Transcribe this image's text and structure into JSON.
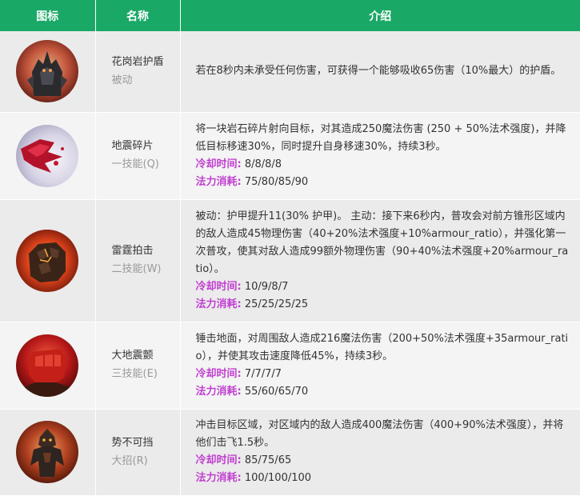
{
  "headers": {
    "icon": "图标",
    "name": "名称",
    "desc": "介绍"
  },
  "colors": {
    "header_bg": "#1aa866",
    "stat_label": "#c03fd0"
  },
  "skills": [
    {
      "name": "花岗岩护盾",
      "type": "被动",
      "icon": "stone-golem-icon",
      "desc": "若在8秒内未承受任何伤害，可获得一个能够吸收65伤害（10%最大）的护盾。",
      "cooldown_label": "",
      "cooldown": "",
      "cost_label": "",
      "cost": ""
    },
    {
      "name": "地震碎片",
      "type": "一技能(Q)",
      "icon": "crystal-shard-icon",
      "desc": "将一块岩石碎片射向目标，对其造成250魔法伤害 (250 + 50%法术强度)，并降低目标移速30%，同时提升自身移速30%，持续3秒。",
      "cooldown_label": "冷却时间:",
      "cooldown": "8/8/8/8",
      "cost_label": "法力消耗:",
      "cost": "75/80/85/90"
    },
    {
      "name": "雷霆拍击",
      "type": "二技能(W)",
      "icon": "molten-fist-icon",
      "desc": "被动：护甲提升11(30% 护甲)。 主动：接下来6秒内，普攻会对前方锥形区域内的敌人造成45物理伤害（40+20%法术强度+10%armour_ratio），并强化第一次普攻，使其对敌人造成99额外物理伤害（90+40%法术强度+20%armour_ratio）。",
      "cooldown_label": "冷却时间:",
      "cooldown": "10/9/8/7",
      "cost_label": "法力消耗:",
      "cost": "25/25/25/25"
    },
    {
      "name": "大地震颤",
      "type": "三技能(E)",
      "icon": "red-fist-icon",
      "desc": "锤击地面，对周围敌人造成216魔法伤害（200+50%法术强度+35armour_ratio），并使其攻击速度降低45%，持续3秒。",
      "cooldown_label": "冷却时间:",
      "cooldown": "7/7/7/7",
      "cost_label": "法力消耗:",
      "cost": "55/60/65/70"
    },
    {
      "name": "势不可挡",
      "type": "大招(R)",
      "icon": "charging-golem-icon",
      "desc": "冲击目标区域，对区域内的敌人造成400魔法伤害（400+90%法术强度），并将他们击飞1.5秒。",
      "cooldown_label": "冷却时间:",
      "cooldown": "85/75/65",
      "cost_label": "法力消耗:",
      "cost": "100/100/100"
    }
  ]
}
